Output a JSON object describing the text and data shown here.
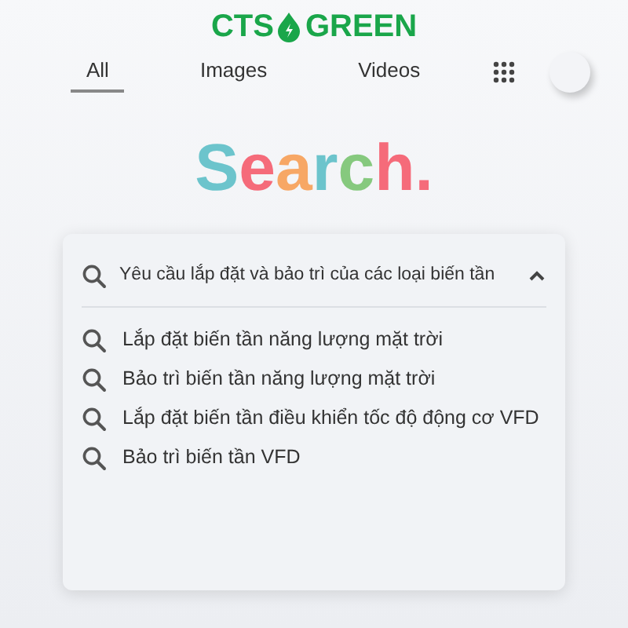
{
  "logo": {
    "left": "CTS",
    "right": "GREEN"
  },
  "tabs": [
    {
      "label": "All",
      "selected": true
    },
    {
      "label": "Images",
      "selected": false
    },
    {
      "label": "Videos",
      "selected": false
    }
  ],
  "title_letters": [
    {
      "text": "S",
      "color": "#6cc4cc"
    },
    {
      "text": "e",
      "color": "#f56b7a"
    },
    {
      "text": "a",
      "color": "#f7a765"
    },
    {
      "text": "r",
      "color": "#6cc4cc"
    },
    {
      "text": "c",
      "color": "#86c97e"
    },
    {
      "text": "h",
      "color": "#f56b7a"
    },
    {
      "text": ".",
      "color": "#f56b7a"
    }
  ],
  "search": {
    "query": "Yêu cầu lắp đặt và bảo trì của các loại biến tần",
    "expanded": true
  },
  "suggestions": [
    "Lắp đặt biến tần năng lượng mặt trời",
    "Bảo trì biến tần năng lượng mặt trời",
    "Lắp đặt biến tần điều khiển tốc độ động cơ VFD",
    "Bảo trì biến tần VFD"
  ]
}
